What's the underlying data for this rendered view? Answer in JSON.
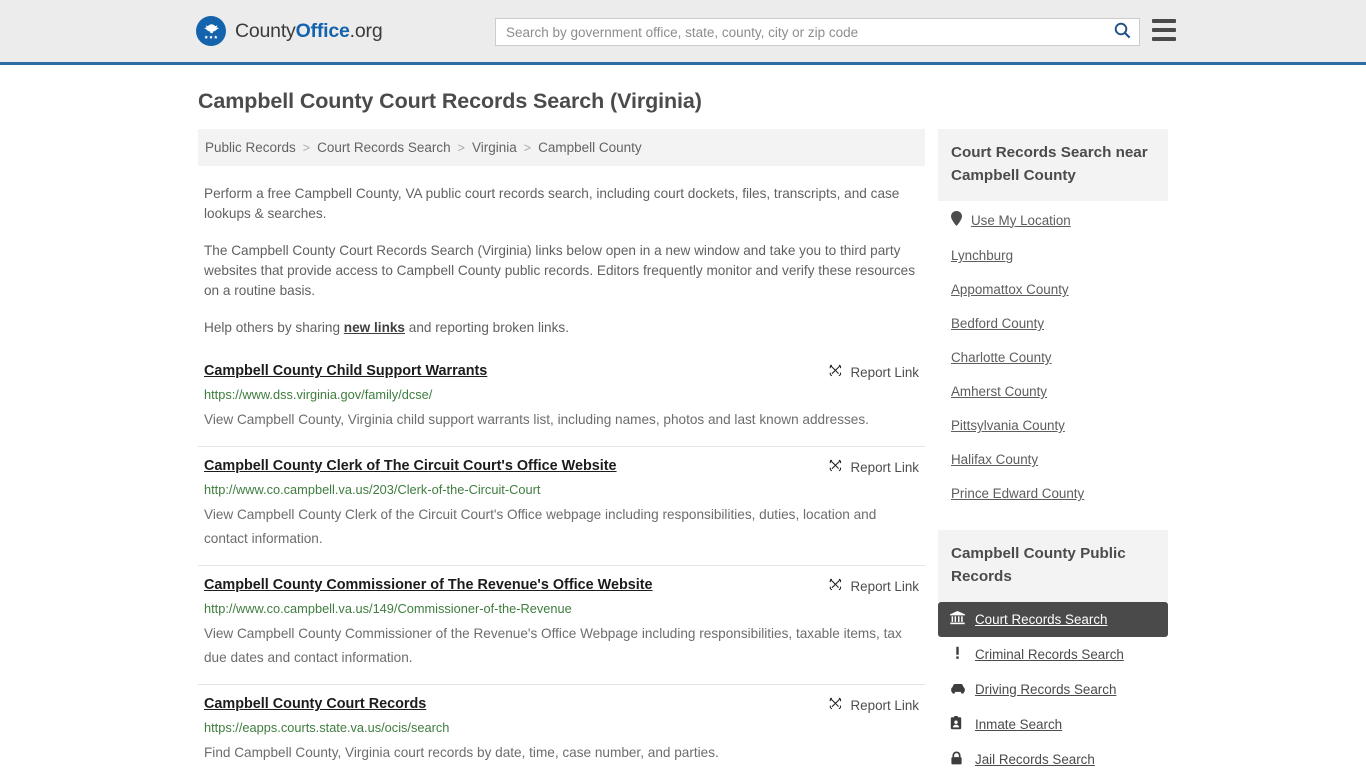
{
  "header": {
    "brand": {
      "part1": "County",
      "part2": "Office",
      "part3": ".org",
      "logo_icon": "eagle-stars-logo"
    },
    "search": {
      "placeholder": "Search by government office, state, county, city or zip code",
      "value": "",
      "button_icon": "search-icon"
    },
    "menu_icon": "hamburger-menu-icon",
    "accent_color": "#2d6ca2",
    "background_color": "#ececec"
  },
  "page_title": "Campbell County Court Records Search (Virginia)",
  "breadcrumb": {
    "items": [
      {
        "label": "Public Records"
      },
      {
        "label": "Court Records Search"
      },
      {
        "label": "Virginia"
      },
      {
        "label": "Campbell County"
      }
    ],
    "separator": ">"
  },
  "intro": {
    "paragraph1": "Perform a free Campbell County, VA public court records search, including court dockets, files, transcripts, and case lookups & searches.",
    "paragraph2": "The Campbell County Court Records Search (Virginia) links below open in a new window and take you to third party websites that provide access to Campbell County public records. Editors frequently monitor and verify these resources on a routine basis.",
    "paragraph3_before": "Help others by sharing ",
    "paragraph3_link": "new links",
    "paragraph3_after": " and reporting broken links."
  },
  "results": {
    "report_label": "Report Link",
    "report_icon": "broken-link-icon",
    "items": [
      {
        "title": "Campbell County Child Support Warrants",
        "url": "https://www.dss.virginia.gov/family/dcse/",
        "description": "View Campbell County, Virginia child support warrants list, including names, photos and last known addresses."
      },
      {
        "title": "Campbell County Clerk of The Circuit Court's Office Website",
        "url": "http://www.co.campbell.va.us/203/Clerk-of-the-Circuit-Court",
        "description": "View Campbell County Clerk of the Circuit Court's Office webpage including responsibilities, duties, location and contact information."
      },
      {
        "title": "Campbell County Commissioner of The Revenue's Office Website",
        "url": "http://www.co.campbell.va.us/149/Commissioner-of-the-Revenue",
        "description": "View Campbell County Commissioner of the Revenue's Office Webpage including responsibilities, taxable items, tax due dates and contact information."
      },
      {
        "title": "Campbell County Court Records",
        "url": "https://eapps.courts.state.va.us/ocis/search",
        "description": "Find Campbell County, Virginia court records by date, time, case number, and parties."
      }
    ]
  },
  "sidebar": {
    "near_panel": {
      "title": "Court Records Search near Campbell County",
      "items": [
        {
          "label": "Use My Location",
          "icon": "map-pin-icon"
        },
        {
          "label": "Lynchburg",
          "icon": ""
        },
        {
          "label": "Appomattox County",
          "icon": ""
        },
        {
          "label": "Bedford County",
          "icon": ""
        },
        {
          "label": "Charlotte County",
          "icon": ""
        },
        {
          "label": "Amherst County",
          "icon": ""
        },
        {
          "label": "Pittsylvania County",
          "icon": ""
        },
        {
          "label": "Halifax County",
          "icon": ""
        },
        {
          "label": "Prince Edward County",
          "icon": ""
        }
      ]
    },
    "records_panel": {
      "title": "Campbell County Public Records",
      "active_background": "#4a4a4a",
      "items": [
        {
          "label": "Court Records Search",
          "icon": "courthouse-icon",
          "active": true
        },
        {
          "label": "Criminal Records Search",
          "icon": "exclamation-icon",
          "active": false
        },
        {
          "label": "Driving Records Search",
          "icon": "car-icon",
          "active": false
        },
        {
          "label": "Inmate Search",
          "icon": "id-badge-icon",
          "active": false
        },
        {
          "label": "Jail Records Search",
          "icon": "lock-icon",
          "active": false
        }
      ]
    }
  }
}
